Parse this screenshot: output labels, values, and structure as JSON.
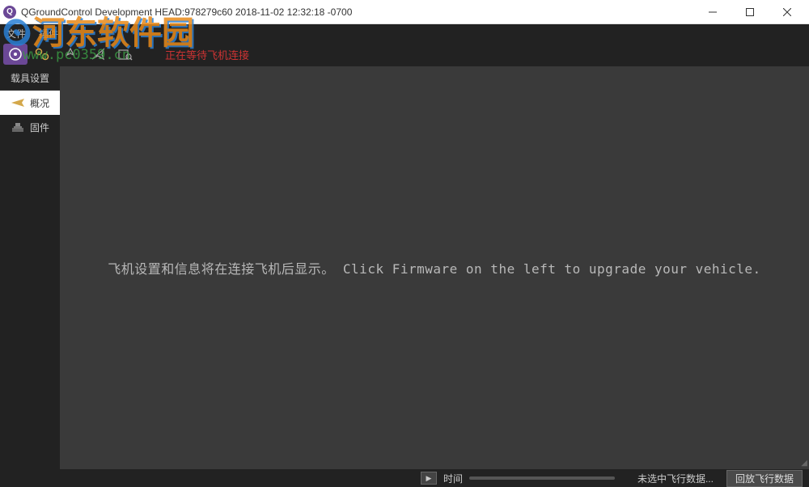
{
  "window": {
    "title": "QGroundControl Development HEAD:978279c60 2018-11-02 12:32:18 -0700",
    "icon_letter": "Q"
  },
  "menubar": {
    "items": [
      "文件",
      "插件"
    ]
  },
  "toolbar": {
    "status_text": "正在等待飞机连接"
  },
  "sidebar": {
    "header": "载具设置",
    "items": [
      {
        "label": "概况",
        "active": true
      },
      {
        "label": "固件",
        "active": false
      }
    ]
  },
  "content": {
    "main_message": "飞机设置和信息将在连接飞机后显示。 Click Firmware on the left to upgrade your vehicle."
  },
  "statusbar": {
    "time_label": "时间",
    "data_label": "未选中飞行数据...",
    "replay_button": "回放飞行数据"
  },
  "watermark": {
    "logo_text": "河东软件园",
    "url": "www.pc0359.cn"
  }
}
